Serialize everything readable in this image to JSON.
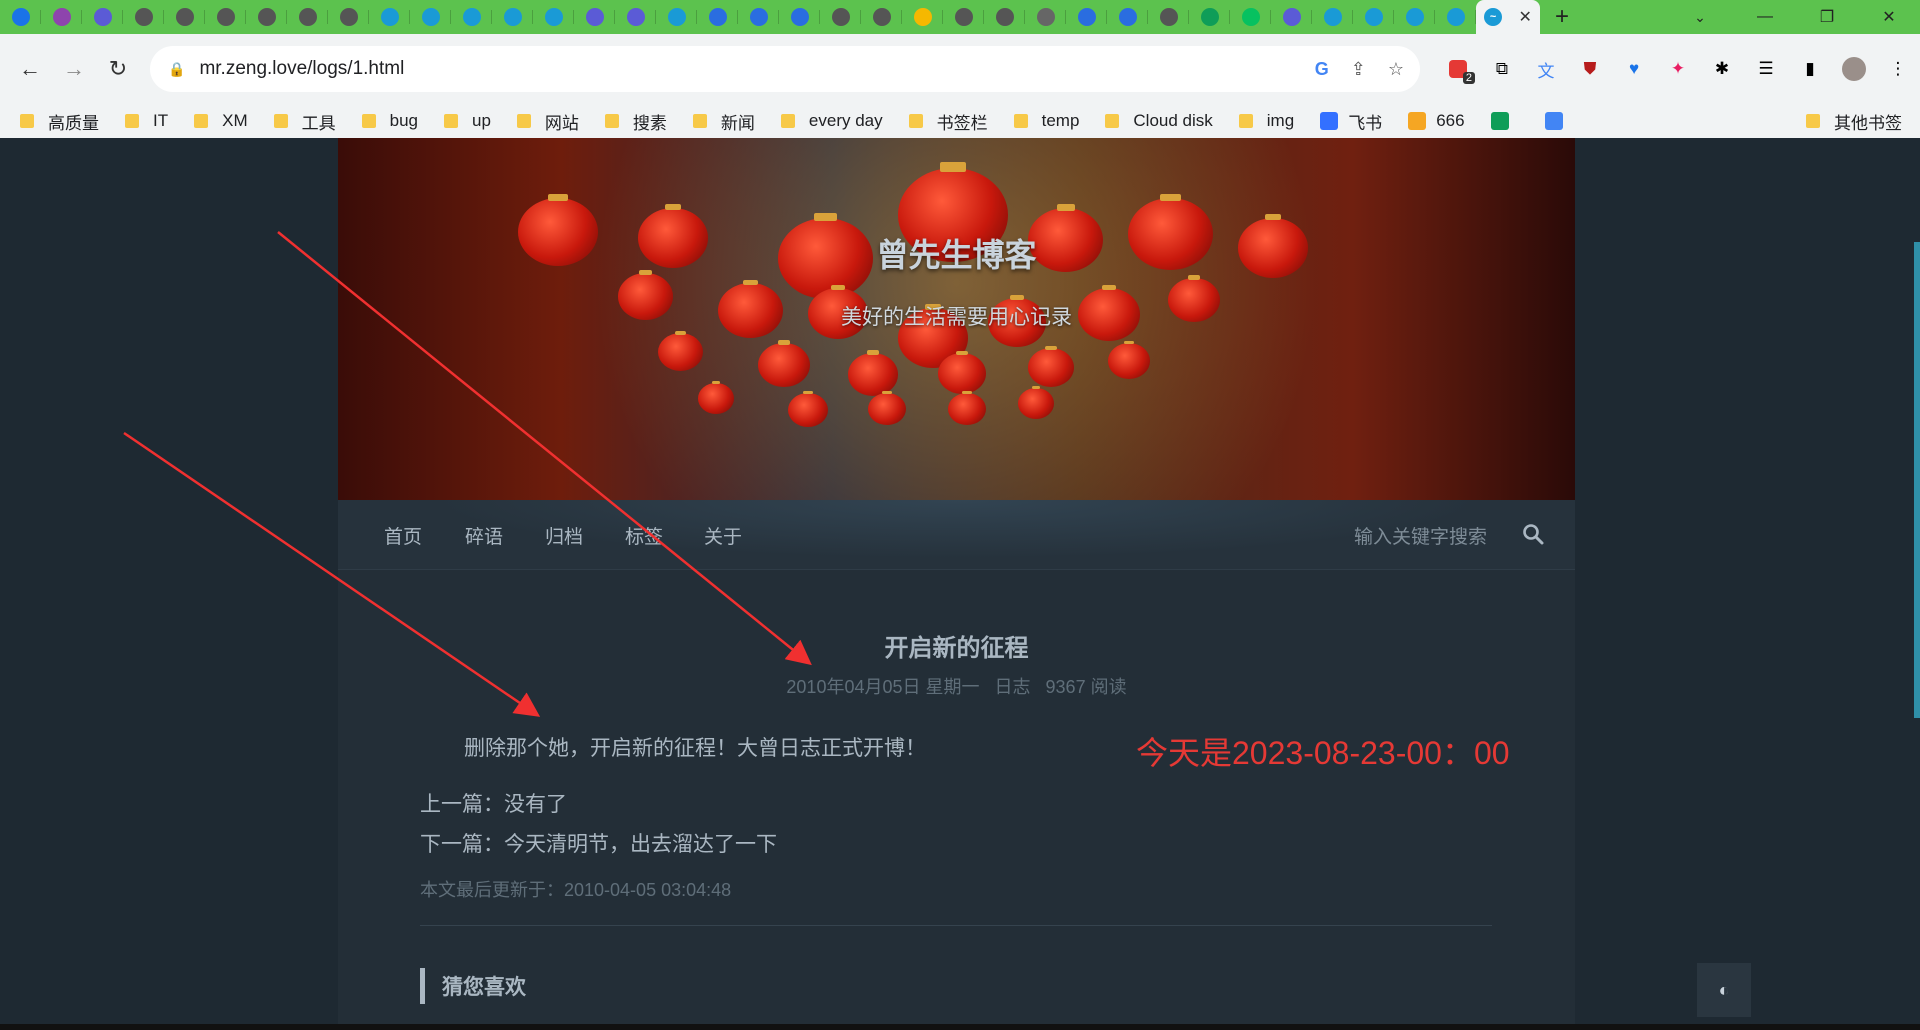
{
  "browser": {
    "tabs": [
      {
        "icon": "heart-shield-icon",
        "color": "#1a73e8"
      },
      {
        "icon": "robot-icon",
        "color": "#8e44ad"
      },
      {
        "icon": "circle-app-icon",
        "color": "#5b5bd6"
      },
      {
        "icon": "globe-icon",
        "color": "#555555"
      },
      {
        "icon": "globe-icon",
        "color": "#555555"
      },
      {
        "icon": "globe-icon",
        "color": "#555555"
      },
      {
        "icon": "globe-icon",
        "color": "#555555"
      },
      {
        "icon": "globe-icon",
        "color": "#555555"
      },
      {
        "icon": "globe-icon",
        "color": "#555555"
      },
      {
        "icon": "pinwheel-icon",
        "color": "#1a9ad6"
      },
      {
        "icon": "pinwheel-icon",
        "color": "#1a9ad6"
      },
      {
        "icon": "pinwheel-icon",
        "color": "#1a9ad6"
      },
      {
        "icon": "pinwheel-icon",
        "color": "#1a9ad6"
      },
      {
        "icon": "pinwheel-icon",
        "color": "#1a9ad6"
      },
      {
        "icon": "circle-app-icon",
        "color": "#5b5bd6"
      },
      {
        "icon": "circle-app-icon",
        "color": "#5b5bd6"
      },
      {
        "icon": "tv-icon",
        "color": "#1a9ad6"
      },
      {
        "icon": "cloud-icon",
        "color": "#2a6de0"
      },
      {
        "icon": "cloud-icon",
        "color": "#2a6de0"
      },
      {
        "icon": "cloud-icon",
        "color": "#2a6de0"
      },
      {
        "icon": "globe-icon",
        "color": "#555555"
      },
      {
        "icon": "globe-icon",
        "color": "#555555"
      },
      {
        "icon": "note-icon",
        "color": "#f5b800"
      },
      {
        "icon": "globe-icon",
        "color": "#555555"
      },
      {
        "icon": "globe-icon",
        "color": "#555555"
      },
      {
        "icon": "camera-icon",
        "color": "#666666"
      },
      {
        "icon": "cloud-icon",
        "color": "#2a6de0"
      },
      {
        "icon": "cloud-icon",
        "color": "#2a6de0"
      },
      {
        "icon": "globe-icon",
        "color": "#555555"
      },
      {
        "icon": "sheet-icon",
        "color": "#0f9d58"
      },
      {
        "icon": "wechat-icon",
        "color": "#07c160"
      },
      {
        "icon": "circle-app-icon",
        "color": "#5b5bd6"
      },
      {
        "icon": "tv-icon",
        "color": "#1a9ad6"
      },
      {
        "icon": "tv-icon",
        "color": "#1a9ad6"
      },
      {
        "icon": "tv-icon",
        "color": "#1a9ad6"
      },
      {
        "icon": "wave-icon",
        "color": "#1a9ad6"
      }
    ],
    "url": "mr.zeng.love/logs/1.html",
    "bookmarks": [
      {
        "label": "高质量",
        "type": "folder"
      },
      {
        "label": "IT",
        "type": "folder"
      },
      {
        "label": "XM",
        "type": "folder"
      },
      {
        "label": "工具",
        "type": "folder"
      },
      {
        "label": "bug",
        "type": "folder"
      },
      {
        "label": "up",
        "type": "folder"
      },
      {
        "label": "网站",
        "type": "folder"
      },
      {
        "label": "搜素",
        "type": "folder"
      },
      {
        "label": "新闻",
        "type": "folder"
      },
      {
        "label": "every day",
        "type": "folder"
      },
      {
        "label": "书签栏",
        "type": "folder"
      },
      {
        "label": "temp",
        "type": "folder"
      },
      {
        "label": "Cloud disk",
        "type": "folder"
      },
      {
        "label": "img",
        "type": "folder"
      },
      {
        "label": "飞书",
        "type": "site",
        "color": "#3370ff"
      },
      {
        "label": "666",
        "type": "site",
        "color": "#f5a623"
      },
      {
        "label": "",
        "type": "site",
        "color": "#0f9d58"
      },
      {
        "label": "",
        "type": "site",
        "color": "#4285f4"
      }
    ],
    "other_bookmarks": "其他书签",
    "extension_badge": "2"
  },
  "site": {
    "title": "曾先生博客",
    "subtitle": "美好的生活需要用心记录",
    "nav": [
      "首页",
      "碎语",
      "归档",
      "标签",
      "关于"
    ],
    "search_placeholder": "输入关键字搜索"
  },
  "post": {
    "title": "开启新的征程",
    "date": "2010年04月05日 星期一",
    "category": "日志",
    "reads": "9367 阅读",
    "body": "删除那个她，开启新的征程！大曾日志正式开博！",
    "today": "今天是2023-08-23-00：00",
    "prev": "上一篇：没有了",
    "next": "下一篇：今天清明节，出去溜达了一下",
    "updated": "本文最后更新于：2010-04-05 03:04:48",
    "related_heading": "猜您喜欢"
  },
  "colors": {
    "accent_red": "#e53935",
    "tab_bar": "#5cc24e",
    "page_bg": "#1e2932"
  }
}
